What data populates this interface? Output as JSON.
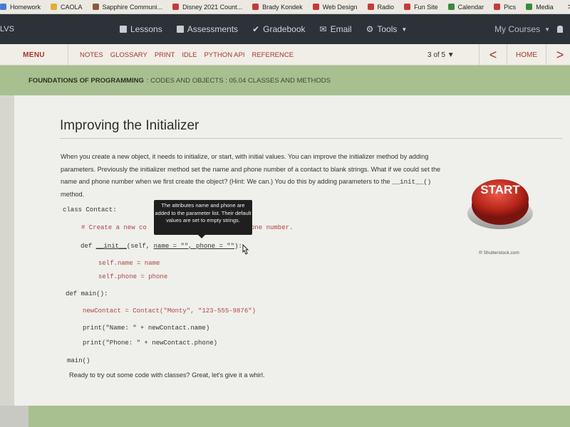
{
  "bookmarks": [
    {
      "label": "Homework",
      "color": "#4a7bd0"
    },
    {
      "label": "CAOLA",
      "color": "#e0b030"
    },
    {
      "label": "Sapphire Communi...",
      "color": "#8a5a3a"
    },
    {
      "label": "Disney 2021 Count...",
      "color": "#c63a3a"
    },
    {
      "label": "Brady Kondek",
      "color": "#c63a3a"
    },
    {
      "label": "Web Design",
      "color": "#c63a3a"
    },
    {
      "label": "Radio",
      "color": "#c63a3a"
    },
    {
      "label": "Fun Site",
      "color": "#c63a3a"
    },
    {
      "label": "Calendar",
      "color": "#3a8a3a"
    },
    {
      "label": "Pics",
      "color": "#c63a3a"
    },
    {
      "label": "Media",
      "color": "#3a8a3a"
    }
  ],
  "bookmarks_more": ">",
  "topnav": {
    "brand": "LVS",
    "items": [
      {
        "label": "Lessons",
        "icon": "book-icon"
      },
      {
        "label": "Assessments",
        "icon": "inbox-icon"
      },
      {
        "label": "Gradebook",
        "icon": "checkmark-icon"
      },
      {
        "label": "Email",
        "icon": "envelope-icon"
      },
      {
        "label": "Tools",
        "icon": "gear-icon"
      }
    ],
    "my_courses": "My Courses"
  },
  "menubar": {
    "menu": "MENU",
    "links": [
      "NOTES",
      "GLOSSARY",
      "PRINT",
      "IDLE",
      "PYTHON API",
      "REFERENCE"
    ],
    "page_of": "3 of 5 ▼",
    "prev": "<",
    "home": "HOME",
    "next": ">"
  },
  "breadcrumb": {
    "course": "FOUNDATIONS OF PROGRAMMING",
    "rest": ": CODES AND OBJECTS : 05.04 CLASSES AND METHODS"
  },
  "content": {
    "title": "Improving the Initializer",
    "para_main": "When you create a new object, it needs to initialize, or start, with initial values. You can improve the initializer method by adding parameters. Previously the initializer method set the name and phone number of a contact to blank strings. What if we could set the name and phone number when we first create the object? (Hint: We can.) You do this by adding parameters to the ",
    "para_code": "__init__()",
    "para_end": " method.",
    "code": {
      "l1": "class Contact:",
      "l2a": "# Create a new co",
      "l2b": "one number.",
      "l3a": "def ",
      "l3b": "__init__",
      "l3c": "(self, ",
      "l3d": "name = \"\", phone = \"\"",
      "l3e": "):",
      "l4": "self.name = name",
      "l5": "self.phone = phone",
      "l6": "def main():",
      "l7": "newContact = Contact(\"Monty\", \"123-555-9876\")",
      "l8": "print(\"Name: \" + newContact.name)",
      "l9": "print(\"Phone: \" + newContact.phone)",
      "l10": "main()"
    },
    "tooltip": "The attributes name and phone are added to the parameter list. Their default values are set to empty strings.",
    "ready": "Ready to try out some code with classes? Great, let's give it a whirl.",
    "start_label": "START",
    "credit": "® Shutterstock.com"
  },
  "colors": {
    "nav_bg": "#2d3238",
    "accent_red": "#a6362c",
    "band_green": "#a8c08f",
    "code_red": "#b0463a"
  }
}
